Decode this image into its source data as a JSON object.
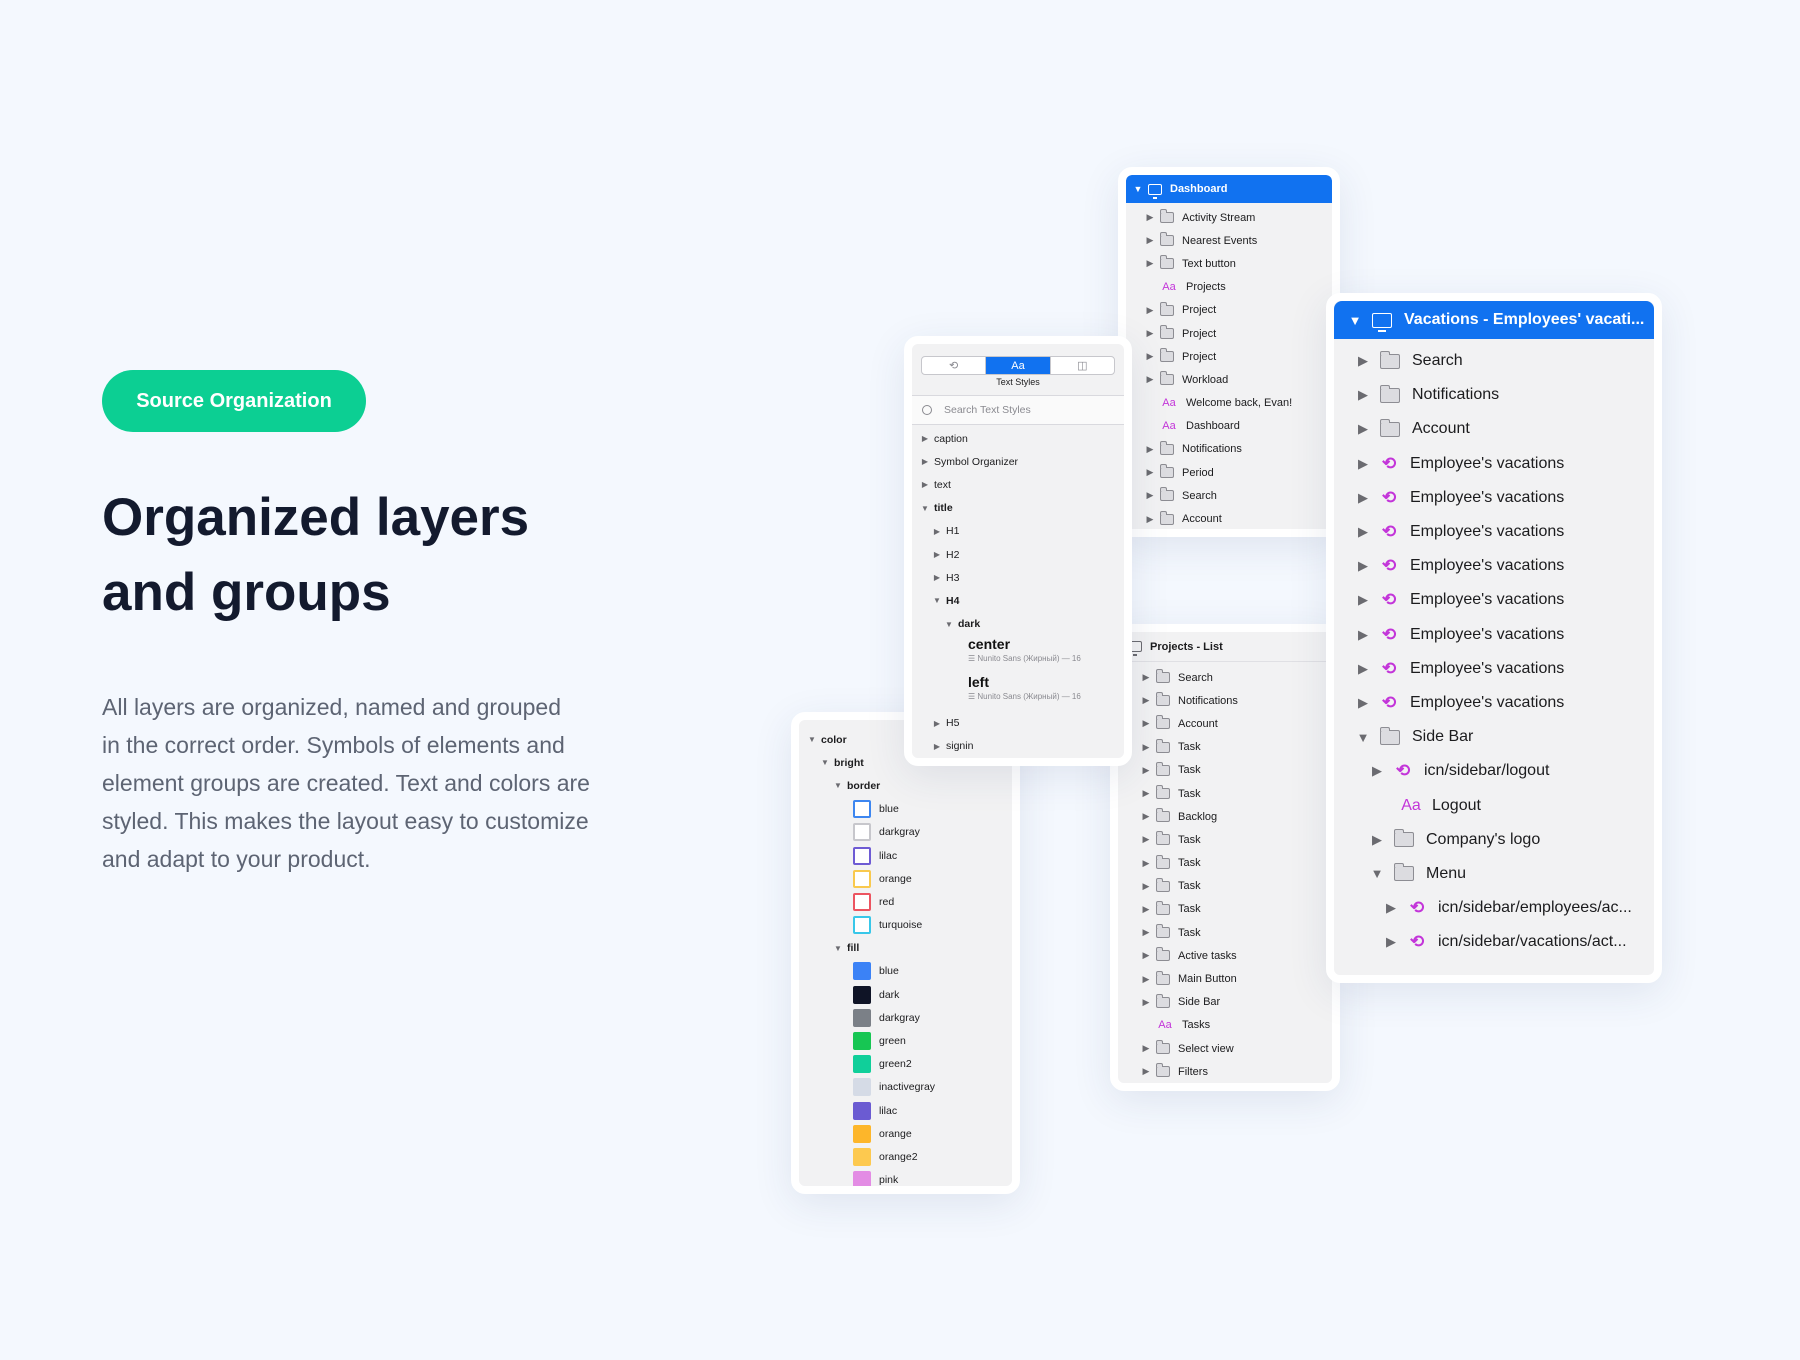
{
  "hero": {
    "badge": "Source Organization",
    "headline_lines": [
      "Organized layers",
      "and groups"
    ],
    "description_lines": [
      "All layers are organized, named and grouped",
      "in the correct order. Symbols of elements and",
      "element groups are created. Text and colors are",
      "styled. This makes the layout easy to customize",
      "and adapt to your product."
    ]
  },
  "dashboard_panel": {
    "title": "Dashboard",
    "items": [
      {
        "type": "folder",
        "label": "Activity Stream"
      },
      {
        "type": "folder",
        "label": "Nearest Events"
      },
      {
        "type": "folder",
        "label": "Text button"
      },
      {
        "type": "text",
        "label": "Projects"
      },
      {
        "type": "folder",
        "label": "Project"
      },
      {
        "type": "folder",
        "label": "Project"
      },
      {
        "type": "folder",
        "label": "Project"
      },
      {
        "type": "folder",
        "label": "Workload"
      },
      {
        "type": "text",
        "label": "Welcome back, Evan!"
      },
      {
        "type": "text",
        "label": "Dashboard"
      },
      {
        "type": "folder",
        "label": "Notifications"
      },
      {
        "type": "folder",
        "label": "Period"
      },
      {
        "type": "folder",
        "label": "Search"
      },
      {
        "type": "folder",
        "label": "Account"
      }
    ]
  },
  "projects_panel": {
    "title": "Projects - List",
    "items": [
      {
        "type": "folder",
        "label": "Search"
      },
      {
        "type": "folder",
        "label": "Notifications"
      },
      {
        "type": "folder",
        "label": "Account"
      },
      {
        "type": "folder",
        "label": "Task"
      },
      {
        "type": "folder",
        "label": "Task"
      },
      {
        "type": "folder",
        "label": "Task"
      },
      {
        "type": "folder",
        "label": "Backlog"
      },
      {
        "type": "folder",
        "label": "Task"
      },
      {
        "type": "folder",
        "label": "Task"
      },
      {
        "type": "folder",
        "label": "Task"
      },
      {
        "type": "folder",
        "label": "Task"
      },
      {
        "type": "folder",
        "label": "Task"
      },
      {
        "type": "folder",
        "label": "Active tasks"
      },
      {
        "type": "folder",
        "label": "Main Button"
      },
      {
        "type": "folder",
        "label": "Side Bar"
      },
      {
        "type": "text",
        "label": "Tasks"
      },
      {
        "type": "folder",
        "label": "Select view"
      },
      {
        "type": "folder",
        "label": "Filters"
      }
    ]
  },
  "vacations_panel": {
    "title": "Vacations - Employees' vacati...",
    "items": [
      {
        "type": "folder",
        "label": "Search",
        "level": 0,
        "open": false
      },
      {
        "type": "folder",
        "label": "Notifications",
        "level": 0,
        "open": false
      },
      {
        "type": "folder",
        "label": "Account",
        "level": 0,
        "open": false
      },
      {
        "type": "symbol",
        "label": "Employee's vacations",
        "level": 0,
        "open": false
      },
      {
        "type": "symbol",
        "label": "Employee's vacations",
        "level": 0,
        "open": false
      },
      {
        "type": "symbol",
        "label": "Employee's vacations",
        "level": 0,
        "open": false
      },
      {
        "type": "symbol",
        "label": "Employee's vacations",
        "level": 0,
        "open": false
      },
      {
        "type": "symbol",
        "label": "Employee's vacations",
        "level": 0,
        "open": false
      },
      {
        "type": "symbol",
        "label": "Employee's vacations",
        "level": 0,
        "open": false
      },
      {
        "type": "symbol",
        "label": "Employee's vacations",
        "level": 0,
        "open": false
      },
      {
        "type": "symbol",
        "label": "Employee's vacations",
        "level": 0,
        "open": false
      },
      {
        "type": "folder",
        "label": "Side Bar",
        "level": 0,
        "open": true
      },
      {
        "type": "symbol",
        "label": "icn/sidebar/logout",
        "level": 1,
        "open": false
      },
      {
        "type": "text",
        "label": "Logout",
        "level": 1
      },
      {
        "type": "folder",
        "label": "Company's logo",
        "level": 1,
        "open": false
      },
      {
        "type": "folder",
        "label": "Menu",
        "level": 1,
        "open": true
      },
      {
        "type": "symbol",
        "label": "icn/sidebar/employees/ac...",
        "level": 2,
        "open": false
      },
      {
        "type": "symbol",
        "label": "icn/sidebar/vacations/act...",
        "level": 2,
        "open": false
      }
    ]
  },
  "text_styles_panel": {
    "segments": [
      {
        "icon": "symbols-icon",
        "label": "",
        "glyph": "⟲"
      },
      {
        "icon": "text-styles-icon",
        "label": "Aa",
        "glyph": ""
      },
      {
        "icon": "layer-styles-icon",
        "label": "",
        "glyph": "◫"
      }
    ],
    "active_segment_label": "Text Styles",
    "search_placeholder": "Search Text Styles",
    "items": [
      {
        "kind": "group",
        "label": "caption",
        "level": 0,
        "open": false
      },
      {
        "kind": "group",
        "label": "Symbol Organizer",
        "level": 0,
        "open": false
      },
      {
        "kind": "group",
        "label": "text",
        "level": 0,
        "open": false
      },
      {
        "kind": "group",
        "label": "title",
        "level": 0,
        "open": true,
        "bold": true
      },
      {
        "kind": "group",
        "label": "H1",
        "level": 1,
        "open": false
      },
      {
        "kind": "group",
        "label": "H2",
        "level": 1,
        "open": false
      },
      {
        "kind": "group",
        "label": "H3",
        "level": 1,
        "open": false
      },
      {
        "kind": "group",
        "label": "H4",
        "level": 1,
        "open": true,
        "bold": true
      },
      {
        "kind": "group",
        "label": "dark",
        "level": 2,
        "open": true,
        "bold": true
      },
      {
        "kind": "style",
        "label": "center",
        "meta": "Nunito Sans (Жирный) — 16"
      },
      {
        "kind": "style",
        "label": "left",
        "meta": "Nunito Sans (Жирный) — 16"
      },
      {
        "kind": "group",
        "label": "H5",
        "level": 1,
        "open": false
      },
      {
        "kind": "group",
        "label": "signin",
        "level": 1,
        "open": false
      }
    ]
  },
  "colors_panel": {
    "items": [
      {
        "kind": "group",
        "label": "color",
        "level": 0
      },
      {
        "kind": "group",
        "label": "bright",
        "level": 1
      },
      {
        "kind": "group",
        "label": "border",
        "level": 2
      },
      {
        "kind": "border",
        "label": "blue",
        "color": "#3d86f0"
      },
      {
        "kind": "border",
        "label": "darkgray",
        "color": "#c7c7cc"
      },
      {
        "kind": "border",
        "label": "lilac",
        "color": "#6e5bd4"
      },
      {
        "kind": "border",
        "label": "orange",
        "color": "#f9c94e"
      },
      {
        "kind": "border",
        "label": "red",
        "color": "#ec5460"
      },
      {
        "kind": "border",
        "label": "turquoise",
        "color": "#38c7e9"
      },
      {
        "kind": "group",
        "label": "fill",
        "level": 2
      },
      {
        "kind": "fill",
        "label": "blue",
        "color": "#3b82f6"
      },
      {
        "kind": "fill",
        "label": "dark",
        "color": "#0f1426"
      },
      {
        "kind": "fill",
        "label": "darkgray",
        "color": "#7b8087"
      },
      {
        "kind": "fill",
        "label": "green",
        "color": "#17c653"
      },
      {
        "kind": "fill",
        "label": "green2",
        "color": "#10cf9a"
      },
      {
        "kind": "fill",
        "label": "inactivegray",
        "color": "#d5dbe6"
      },
      {
        "kind": "fill",
        "label": "lilac",
        "color": "#6b5bd2"
      },
      {
        "kind": "fill",
        "label": "orange",
        "color": "#fdb62a"
      },
      {
        "kind": "fill",
        "label": "orange2",
        "color": "#fdc94f"
      },
      {
        "kind": "fill",
        "label": "pink",
        "color": "#e38ce4"
      }
    ]
  },
  "colors": {
    "accent_blue": "#1172f0",
    "badge_green": "#0ccf93",
    "symbol_purple": "#c335d9"
  }
}
